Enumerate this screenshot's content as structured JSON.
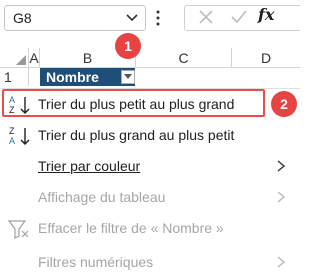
{
  "formula_bar": {
    "name_box_value": "G8",
    "fx_label": "fx"
  },
  "grid": {
    "columns": [
      "A",
      "B",
      "C",
      "D"
    ],
    "row_number": "1",
    "header_cell_value": "Nombre"
  },
  "menu": {
    "items": [
      {
        "label": "Trier du plus petit au plus grand",
        "icon": "sort-ascending-icon",
        "enabled": true,
        "submenu": false
      },
      {
        "label": "Trier du plus grand au plus petit",
        "icon": "sort-descending-icon",
        "enabled": true,
        "submenu": false
      },
      {
        "label": "Trier par couleur",
        "icon": "",
        "enabled": true,
        "submenu": true
      },
      {
        "label": "Affichage du tableau",
        "icon": "",
        "enabled": false,
        "submenu": true
      },
      {
        "label": "Effacer le filtre de « Nombre »",
        "icon": "clear-filter-icon",
        "enabled": false,
        "submenu": false
      },
      {
        "label": "Filtres numériques",
        "icon": "",
        "enabled": false,
        "submenu": true
      }
    ]
  },
  "annotations": {
    "badge_1": "1",
    "badge_2": "2",
    "accent_color": "#e84343"
  }
}
